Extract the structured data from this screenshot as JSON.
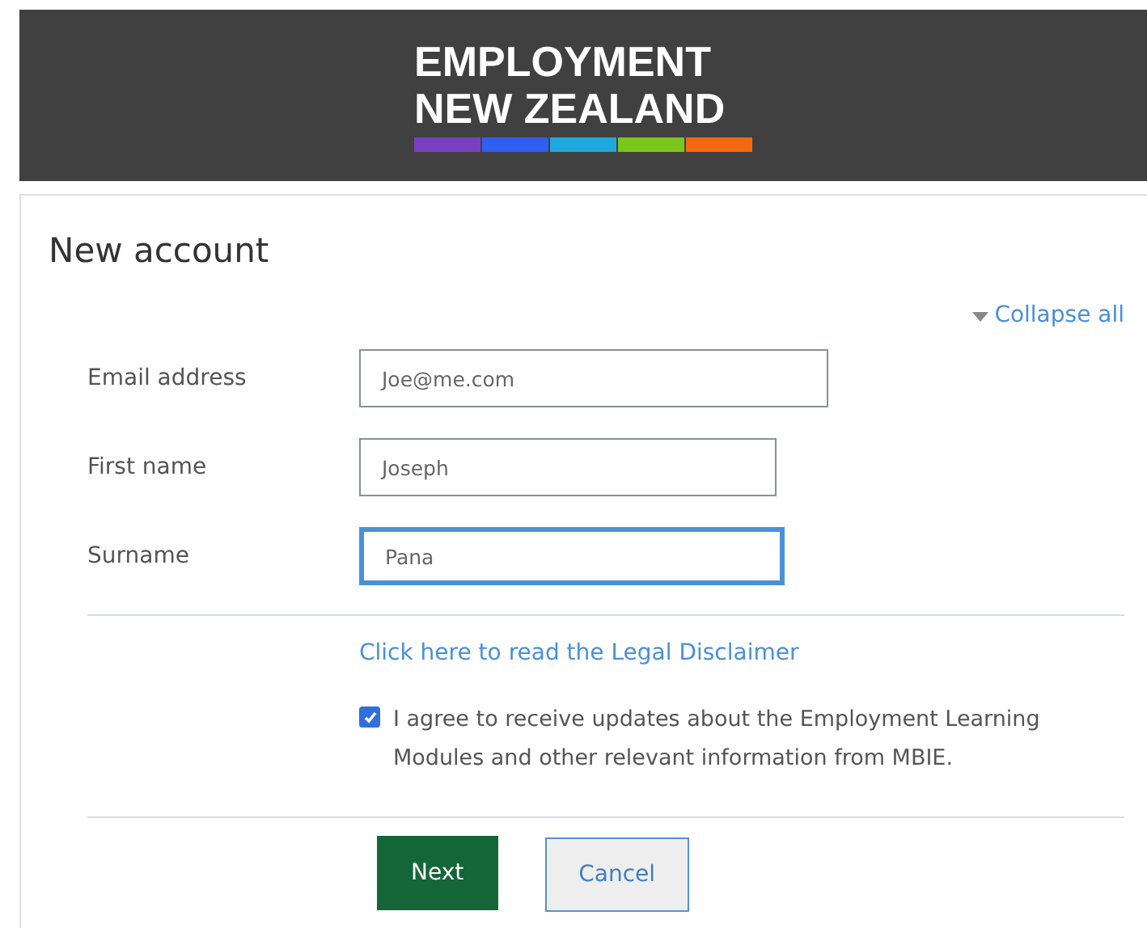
{
  "header": {
    "logo_lines": [
      "EMPLOYMENT",
      "NEW ZEALAND"
    ],
    "logo_stripes": [
      {
        "color": "#7a3fc0"
      },
      {
        "color": "#2f5ef0"
      },
      {
        "color": "#1fa8dc"
      },
      {
        "color": "#7cc51a"
      },
      {
        "color": "#f06a10"
      }
    ]
  },
  "title": "New account",
  "collapse_link": "Collapse all",
  "fields": [
    {
      "label": "Email address",
      "value": "Joe@me.com",
      "focused": false
    },
    {
      "label": "First name",
      "value": "Joseph",
      "focused": false
    },
    {
      "label": "Surname",
      "value": "Pana",
      "focused": true
    }
  ],
  "disclaimer_link": "Click here to read the Legal Disclaimer",
  "agree": {
    "checked": true,
    "text": "I agree to receive updates about the Employment Learning Modules and other relevant information from MBIE."
  },
  "buttons": [
    {
      "label": "Next",
      "kind": "primary"
    },
    {
      "label": "Cancel",
      "kind": "secondary"
    }
  ]
}
